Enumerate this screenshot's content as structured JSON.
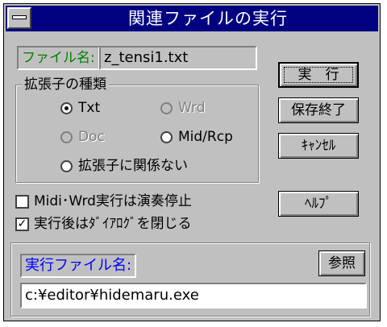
{
  "window": {
    "title": "関連ファイルの実行"
  },
  "file": {
    "label": "ファイル名:",
    "value": "z_tensi1.txt"
  },
  "ext_group": {
    "label": "拡張子の種類",
    "options": [
      {
        "label": "Txt",
        "checked": true,
        "disabled": false
      },
      {
        "label": "Wrd",
        "checked": false,
        "disabled": true
      },
      {
        "label": "Doc",
        "checked": false,
        "disabled": true
      },
      {
        "label": "Mid/Rcp",
        "checked": false,
        "disabled": false
      },
      {
        "label": "拡張子に関係ない",
        "checked": false,
        "disabled": false
      }
    ]
  },
  "checks": [
    {
      "label": "Midi･Wrd実行は演奏停止",
      "checked": false
    },
    {
      "label": "実行後はﾀﾞｲｱﾛｸﾞを閉じる",
      "checked": true
    }
  ],
  "buttons": {
    "run": "実　行",
    "save_exit": "保存終了",
    "cancel": "ｷｬﾝｾﾙ",
    "help": "ﾍﾙﾌﾟ",
    "browse": "参照"
  },
  "exec": {
    "label": "実行ファイル名:",
    "value": "c:¥editor¥hidemaru.exe"
  },
  "colors": {
    "titlebar": "#000080",
    "face": "#c0c0c0",
    "file_label": "#008000",
    "exec_label": "#0000ff"
  }
}
